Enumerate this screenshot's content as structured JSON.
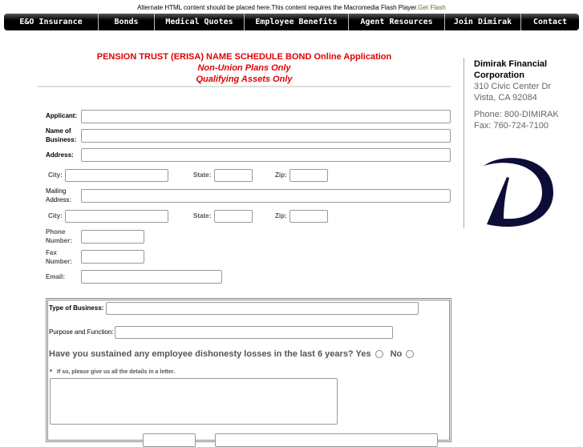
{
  "flash_notice": {
    "text": "Alternate HTML content should be placed here.This content requires the Macromedia Flash Player.",
    "link": "Get Flash"
  },
  "nav": [
    "E&O Insurance",
    "Bonds",
    "Medical Quotes",
    "Employee Benefits",
    "Agent Resources",
    "Join Dimirak",
    "Contact"
  ],
  "heading": {
    "title": "PENSION TRUST (ERISA) NAME SCHEDULE BOND Online Application",
    "sub1": "Non-Union Plans Only",
    "sub2": "Qualifying Assets Only"
  },
  "form": {
    "applicant": "Applicant:",
    "name_of": "Name of",
    "business": "Business:",
    "address": "Address:",
    "city": "City:",
    "state": "State:",
    "zip": "Zip:",
    "mailing": "Mailing",
    "mailing_address": "Address:",
    "phone": "Phone",
    "phone_number": "Number:",
    "fax": "Fax",
    "fax_number": "Number:",
    "email": "Email:"
  },
  "business": {
    "type": "Type of Business:",
    "purpose": "Purpose and Function:",
    "question": "Have you sustained any employee dishonesty losses in the last 6 years?",
    "yes": "Yes",
    "no": "No",
    "details": "If so, please give us all the details in a letter."
  },
  "sidebar": {
    "company1": "Dimirak Financial",
    "company2": "Corporation",
    "addr1": "310 Civic Center Dr",
    "addr2": "Vista, CA 92084",
    "phone": "Phone: 800-DIMIRAK",
    "fax": "Fax: 760-724-7100",
    "logo_letter": "D",
    "logo_color": "#0d0d38"
  }
}
